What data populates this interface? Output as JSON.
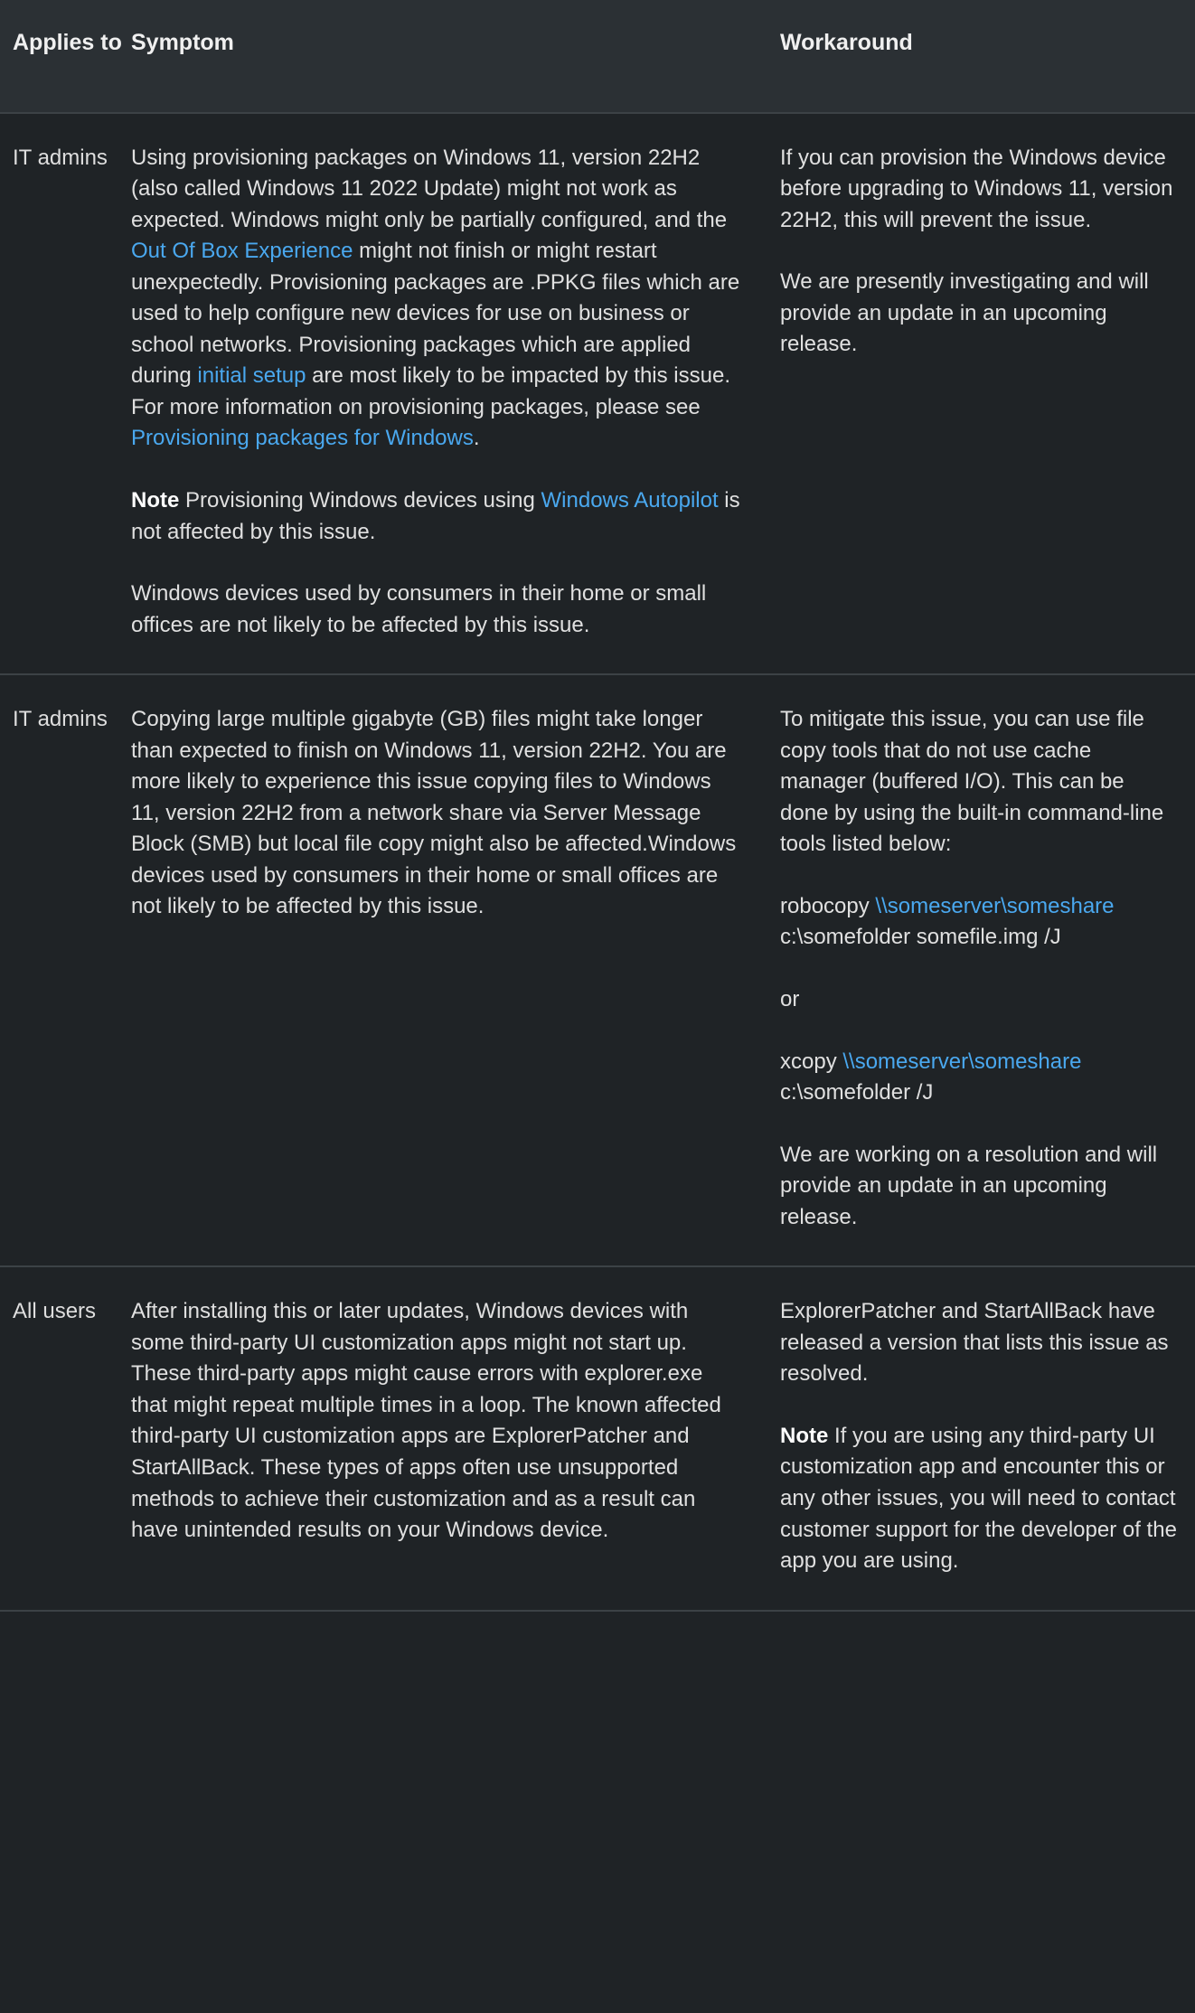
{
  "table": {
    "headers": {
      "applies_to": "Applies to",
      "symptom": "Symptom",
      "workaround": "Workaround"
    },
    "rows": [
      {
        "applies_to": "IT admins",
        "symptom": {
          "p1_a": "Using provisioning packages on Windows 11, version 22H2 (also called Windows 11 2022 Update) might not work as expected. Windows might only be partially configured, and the ",
          "p1_link1": "Out Of Box Experience",
          "p1_b": " might not finish or might restart unexpectedly. Provisioning packages are .PPKG files which are used to help configure new devices for use on business or school networks. Provisioning packages which are applied during ",
          "p1_link2": "initial setup",
          "p1_c": " are most likely to be impacted by this issue. For more information on provisioning packages, please see ",
          "p1_link3": "Provisioning packages for Windows",
          "p1_d": ".",
          "p2_note": "Note",
          "p2_a": " Provisioning Windows devices using ",
          "p2_link1": "Windows Autopilot",
          "p2_b": " is not affected by this issue.",
          "p3": "Windows devices used by consumers in their home or small offices are not likely to be affected by this issue."
        },
        "workaround": {
          "p1": "If you can provision the Windows device before upgrading to Windows 11, version 22H2, this will prevent the issue.",
          "p2": "We are presently investigating and will provide an update in an upcoming release."
        }
      },
      {
        "applies_to": "IT admins",
        "symptom": {
          "p1": "Copying large multiple gigabyte (GB) files might take longer than expected to finish on Windows 11, version 22H2. You are more likely to experience this issue copying files to Windows 11, version 22H2 from a network share via Server Message Block (SMB) but local file copy might also be affected.Windows devices used by consumers in their home or small offices are not likely to be affected by this issue."
        },
        "workaround": {
          "p1": "To mitigate this issue, you can use file copy tools that do not use cache manager (buffered I/O). This can be done by using the built-in command-line tools listed below:",
          "cmd1_name": "robocopy ",
          "cmd1_path": "\\\\someserver\\someshare",
          "cmd1_args": " c:\\somefolder somefile.img /J",
          "or_label": "or",
          "cmd2_name": "xcopy ",
          "cmd2_path": "\\\\someserver\\someshare",
          "cmd2_args": " c:\\somefolder /J",
          "p2": "We are working on a resolution and will provide an update in an upcoming release."
        }
      },
      {
        "applies_to": "All users",
        "symptom": {
          "p1": "After installing this or later updates, Windows devices with some third-party UI customization apps might not start up. These third-party apps might cause errors with explorer.exe that might repeat multiple times in a loop. The known affected third-party UI customization apps are ExplorerPatcher and StartAllBack. These types of apps often use unsupported methods to achieve their customization and as a result can have unintended results on your Windows device."
        },
        "workaround": {
          "p1": "ExplorerPatcher and StartAllBack have released a version that lists this issue as resolved.",
          "p2_note": "Note",
          "p2_a": " If you are using any third-party UI customization app and encounter this or any other issues, you will need to contact customer support for the developer of the app you are using."
        }
      }
    ]
  },
  "colors": {
    "page_background": "#1f2326",
    "header_background": "#2b3034",
    "text": "#e0e0e0",
    "link": "#4aa8ef",
    "border": "#3c4246"
  }
}
